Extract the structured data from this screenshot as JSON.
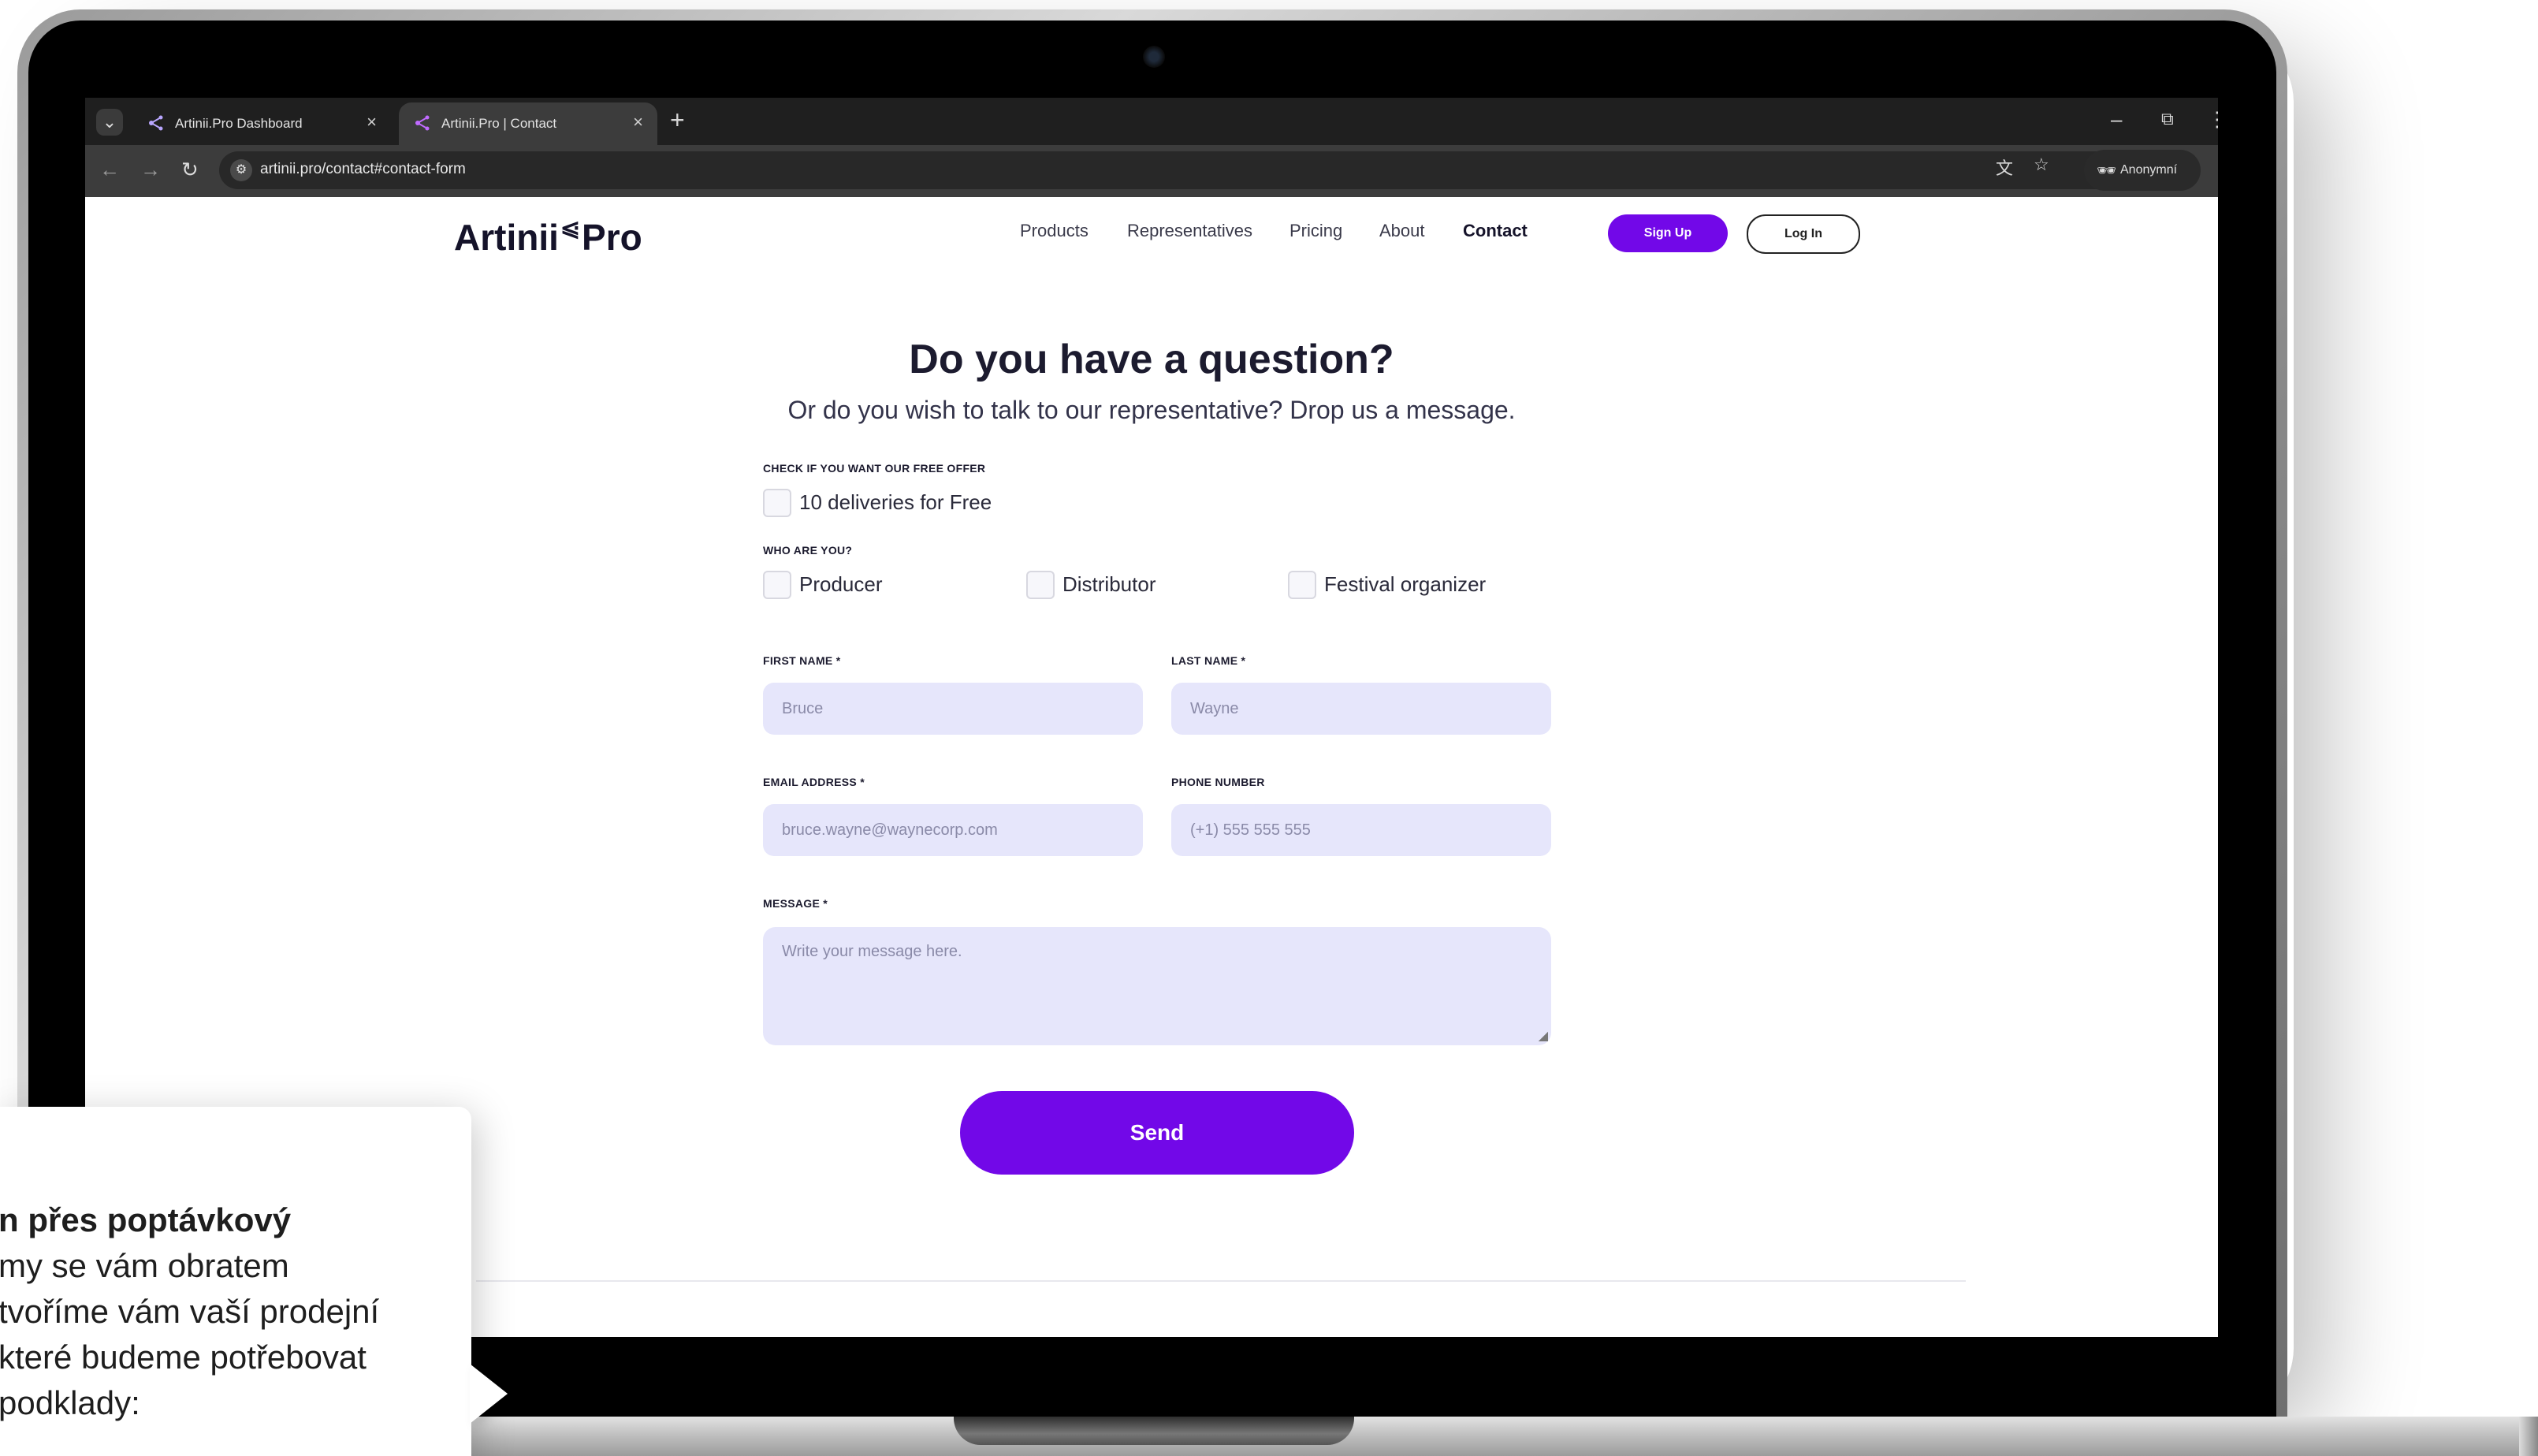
{
  "browser": {
    "tabs": [
      {
        "title": "Artinii.Pro Dashboard",
        "close": "×"
      },
      {
        "title": "Artinii.Pro | Contact",
        "close": "×"
      }
    ],
    "new_tab": "+",
    "tab_list": "⌄",
    "window": {
      "minimize": "–",
      "restore": "⧉",
      "more": "⋮"
    },
    "nav": {
      "back": "←",
      "forward": "→",
      "reload": "↻"
    },
    "url": "artinii.pro/contact#contact-form",
    "translate_icon": "translate-icon",
    "bookmark": "☆",
    "profile_label": "Anonymní"
  },
  "site": {
    "logo": {
      "left": "Artinii",
      "mark": "⩿",
      "right": "Pro"
    },
    "nav": [
      "Products",
      "Representatives",
      "Pricing",
      "About",
      "Contact"
    ],
    "active_nav": "Contact",
    "signup": "Sign Up",
    "login": "Log In",
    "accent_color": "#7208e8",
    "heading": "Do you have a question?",
    "subheading": "Or do you wish to talk to our representative? Drop us a message.",
    "free_offer": {
      "label": "CHECK IF YOU WANT OUR FREE OFFER",
      "option": "10 deliveries for Free"
    },
    "who": {
      "label": "WHO ARE YOU?",
      "options": [
        "Producer",
        "Distributor",
        "Festival organizer"
      ]
    },
    "form": {
      "first_name": {
        "label": "FIRST NAME *",
        "placeholder": "Bruce"
      },
      "last_name": {
        "label": "LAST NAME *",
        "placeholder": "Wayne"
      },
      "email": {
        "label": "EMAIL ADDRESS *",
        "placeholder": "bruce.wayne@waynecorp.com"
      },
      "phone": {
        "label": "PHONE NUMBER",
        "placeholder": "(+1) 555 555 555"
      },
      "message": {
        "label": "MESSAGE *",
        "placeholder": "Write your message here."
      },
      "send": "Send"
    }
  },
  "callout": {
    "lines": [
      "n přes poptávkový",
      "my se vám obratem",
      "tvoříme vám vaší prodejní",
      "které budeme potřebovat",
      "podklady:"
    ]
  }
}
